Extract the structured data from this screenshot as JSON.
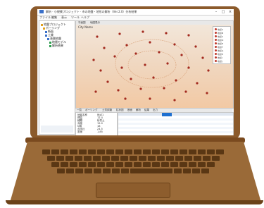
{
  "window": {
    "title": "解析 · 小規模プロジェクト · 市の地盤・地形の解析（Ver.2.0）分析結果",
    "controls": [
      "–",
      "□",
      "×"
    ]
  },
  "menu": {
    "items": [
      "ファイル",
      "編集",
      "表示",
      "ツール",
      "ヘルプ"
    ]
  },
  "tree": {
    "items": [
      "地盤プロジェクト",
      "ボーリング",
      "断面",
      "土質",
      "表層地盤",
      "地層モデル",
      "解析結果"
    ]
  },
  "map": {
    "tabs": [
      "平面図",
      "地図表示"
    ],
    "label": "City Name",
    "legend": [
      "地点A",
      "地点B",
      "地点C",
      "地点D",
      "地点E",
      "地点F",
      "地点G",
      "地点H",
      "地点I",
      "地点J"
    ]
  },
  "bottom_tabs": [
    "一覧",
    "ボーリング",
    "土質試験",
    "柱状図",
    "断面",
    "解析",
    "結果",
    "出力"
  ],
  "properties": [
    {
      "label": "地盤名称",
      "value": "地点1"
    },
    {
      "label": "標高",
      "value": "12.4"
    },
    {
      "label": "種類",
      "value": "砂質土"
    },
    {
      "label": "深度",
      "value": "15.0"
    },
    {
      "label": "N値",
      "value": "18"
    },
    {
      "label": "含水比",
      "value": "24.5"
    },
    {
      "label": "密度",
      "value": "1.85"
    },
    {
      "label": "備考",
      "value": "—"
    }
  ],
  "colors": {
    "lid": "#8b5a2b",
    "base": "#9a6a38",
    "keys": "#5a3714",
    "map_top": "#f3e8dc",
    "map_bottom": "#f2c9a4",
    "marker": "#a32a1f",
    "highlight": "#1e6fd0"
  }
}
